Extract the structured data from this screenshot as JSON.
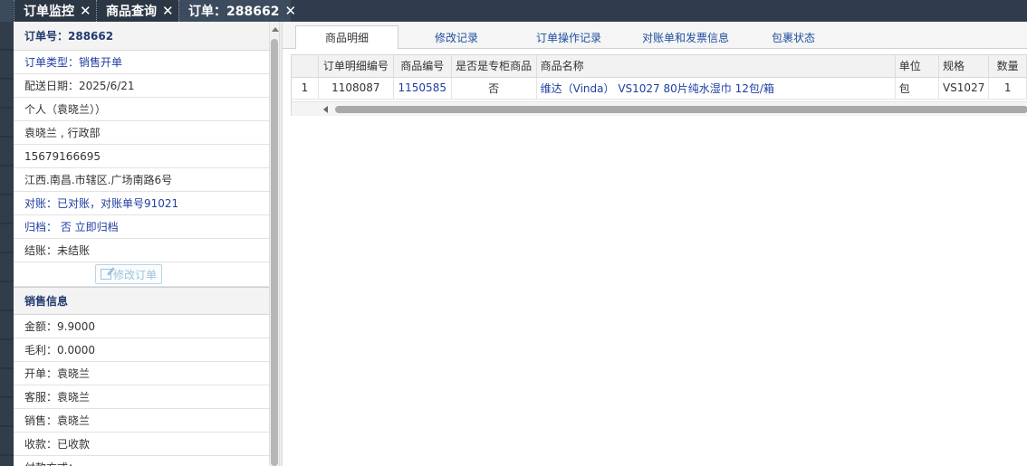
{
  "top_tabs": [
    {
      "label": "订单监控",
      "close": "✕"
    },
    {
      "label": "商品查询",
      "close": "✕"
    },
    {
      "label": "订单：288662",
      "close": "✕"
    }
  ],
  "sidebar": {
    "order_header": "订单号：288662",
    "rows": [
      {
        "text": "订单类型：销售开单",
        "blue": true
      },
      {
        "text": "配送日期：2025/6/21",
        "blue": false
      },
      {
        "text": "个人（袁晓兰））",
        "blue": false
      },
      {
        "text": "袁晓兰 , 行政部",
        "blue": false
      },
      {
        "text": "15679166695",
        "blue": false
      },
      {
        "text": "江西.南昌.市辖区.广场南路6号",
        "blue": false
      },
      {
        "text": "对账：已对账，对账单号91021",
        "blue": true
      },
      {
        "text": "归档：  否 立即归档",
        "blue": true
      },
      {
        "text": "结账：未结账",
        "blue": false
      }
    ],
    "edit_button": "修改订单",
    "sales_header": "销售信息",
    "sales_rows": [
      "金额：9.9000",
      "毛利：0.0000",
      "开单：袁晓兰",
      "客服：袁晓兰",
      "销售：袁晓兰",
      "收款：已收款",
      "付款方式："
    ]
  },
  "panel_tabs": [
    "商品明细",
    "修改记录",
    "订单操作记录",
    "对账单和发票信息",
    "包裹状态"
  ],
  "active_panel_tab": 0,
  "grid": {
    "columns": [
      "",
      "订单明细编号",
      "商品编号",
      "是否是专柜商品",
      "商品名称",
      "单位",
      "规格",
      "数量"
    ],
    "rows": [
      [
        "1",
        "1108087",
        "1150585",
        "否",
        "维达（Vinda） VS1027 80片纯水湿巾 12包/箱",
        "包",
        "VS1027",
        "1"
      ]
    ]
  },
  "colors": {
    "topbar": "#2f3c4d",
    "link_blue": "#1f3ea1",
    "header_navy": "#223a6e"
  }
}
